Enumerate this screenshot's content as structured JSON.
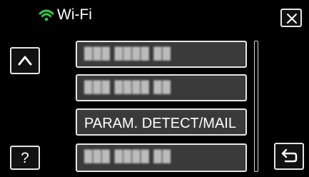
{
  "header": {
    "title": "Wi-Fi",
    "icons": {
      "wifi": "wifi-icon",
      "close": "close-icon"
    }
  },
  "list": {
    "items": [
      {
        "label": "███ ████ ██",
        "obscured": true
      },
      {
        "label": "███ ████ ██",
        "obscured": true
      },
      {
        "label": "PARAM. DETECT/MAIL",
        "obscured": false
      },
      {
        "label": "███ ████ ██",
        "obscured": true
      }
    ]
  },
  "controls": {
    "up": "chevron-up-icon",
    "help_label": "?",
    "back": "return-icon"
  },
  "colors": {
    "background": "#000000",
    "button": "#3a3a3a",
    "border": "#e6e6e6",
    "wifi_green": "#2fc84a"
  }
}
